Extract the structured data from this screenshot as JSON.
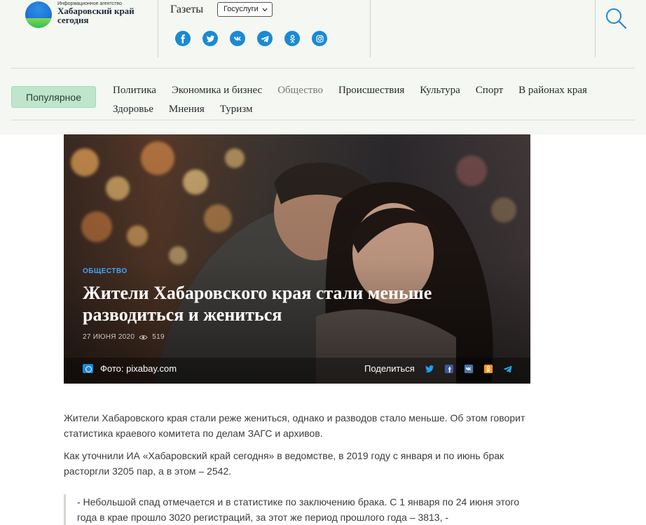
{
  "header": {
    "logo_small": "Информационное агентство",
    "logo_big": "Хабаровский край сегодня",
    "gazety": "Газеты",
    "gosuslugi": "Госуслуги",
    "social_icons": [
      "facebook-icon",
      "twitter-icon",
      "vk-icon",
      "telegram-icon",
      "odnoklassniki-icon",
      "instagram-icon"
    ],
    "accent": "#1a8ad4"
  },
  "popular_button": "Популярное",
  "nav": {
    "row1": [
      "Политика",
      "Экономика и бизнес",
      "Общество",
      "Происшествия",
      "Культура",
      "Спорт",
      "В районах края"
    ],
    "row2": [
      "Здоровье",
      "Мнения",
      "Туризм"
    ]
  },
  "hero": {
    "category": "ОБЩЕСТВО",
    "title": "Жители Хабаровского края стали меньше разводиться и жениться",
    "date": "27 ИЮНЯ 2020",
    "views": "519",
    "photo_credit": "Фото: pixabay.com",
    "share_label": "Поделиться"
  },
  "article": {
    "p1": "Жители Хабаровского края стали реже жениться, однако и разводов стало меньше. Об этом говорит статистика краевого комитета по делам ЗАГС и архивов.",
    "p2": "Как уточнили ИА «Хабаровский край сегодня» в ведомстве, в 2019 году с января и по июнь брак расторгли 3205 пар, а в этом – 2542.",
    "quote": "- Небольшой спад отмечается и в статистике по заключению брака. С 1 января по 24 июня этого года в крае прошло 3020 регистраций, за этот же период прошлого года – 3813, -"
  }
}
